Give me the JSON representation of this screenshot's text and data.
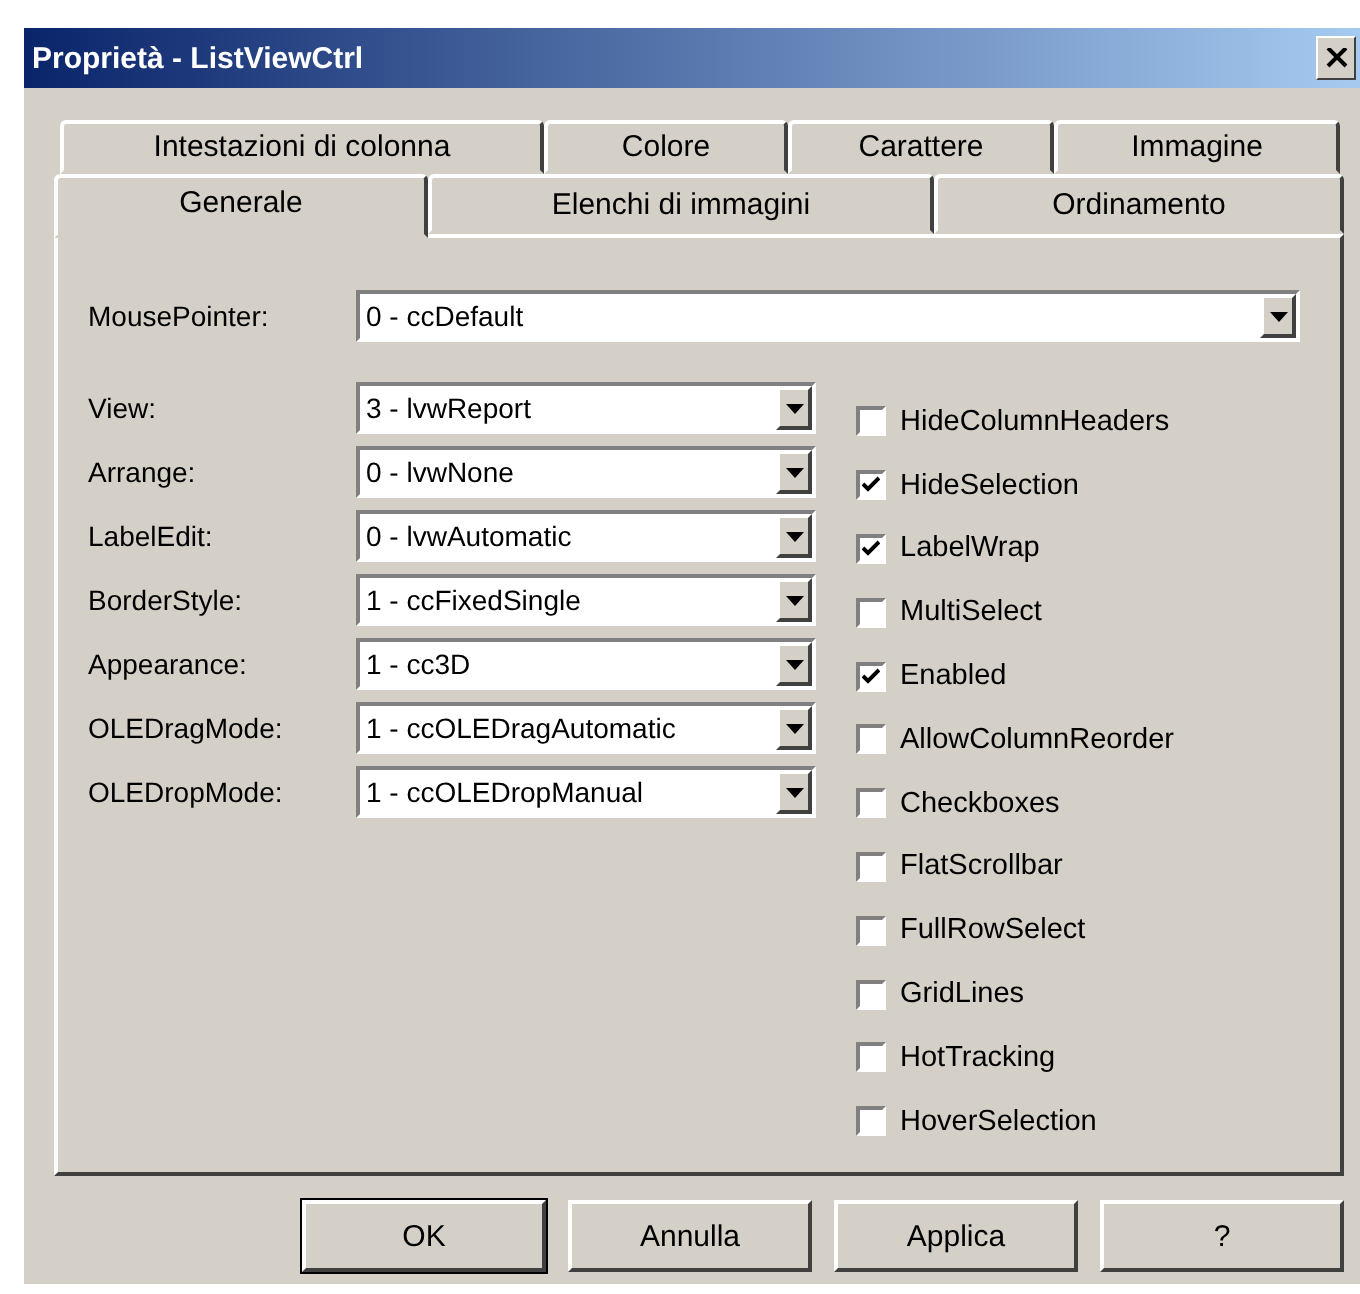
{
  "window": {
    "title": "Proprietà - ListViewCtrl"
  },
  "tab_rows": [
    {
      "tabs": [
        {
          "label": "Intestazioni di colonna",
          "selected": false
        },
        {
          "label": "Colore",
          "selected": false
        },
        {
          "label": "Carattere",
          "selected": false
        },
        {
          "label": "Immagine",
          "selected": false
        }
      ]
    },
    {
      "tabs": [
        {
          "label": "Generale",
          "selected": true
        },
        {
          "label": "Elenchi di immagini",
          "selected": false
        },
        {
          "label": "Ordinamento",
          "selected": false
        }
      ]
    }
  ],
  "mouse_pointer": {
    "label": "MousePointer:",
    "value": "0 - ccDefault"
  },
  "properties": [
    {
      "label": "View:",
      "value": "3 - lvwReport"
    },
    {
      "label": "Arrange:",
      "value": "0 - lvwNone"
    },
    {
      "label": "LabelEdit:",
      "value": "0 - lvwAutomatic"
    },
    {
      "label": "BorderStyle:",
      "value": "1 - ccFixedSingle"
    },
    {
      "label": "Appearance:",
      "value": "1 - cc3D"
    },
    {
      "label": "OLEDragMode:",
      "value": "1 - ccOLEDragAutomatic"
    },
    {
      "label": "OLEDropMode:",
      "value": "1 - ccOLEDropManual"
    }
  ],
  "checkboxes": [
    {
      "label": "HideColumnHeaders",
      "checked": false
    },
    {
      "label": "HideSelection",
      "checked": true
    },
    {
      "label": "LabelWrap",
      "checked": true
    },
    {
      "label": "MultiSelect",
      "checked": false
    },
    {
      "label": "Enabled",
      "checked": true
    },
    {
      "label": "AllowColumnReorder",
      "checked": false
    },
    {
      "label": "Checkboxes",
      "checked": false
    },
    {
      "label": "FlatScrollbar",
      "checked": false
    },
    {
      "label": "FullRowSelect",
      "checked": false
    },
    {
      "label": "GridLines",
      "checked": false
    },
    {
      "label": "HotTracking",
      "checked": false
    },
    {
      "label": "HoverSelection",
      "checked": false
    }
  ],
  "buttons": [
    {
      "label": "OK",
      "default": true
    },
    {
      "label": "Annulla",
      "default": false
    },
    {
      "label": "Applica",
      "default": false
    },
    {
      "label": "?",
      "default": false
    }
  ]
}
